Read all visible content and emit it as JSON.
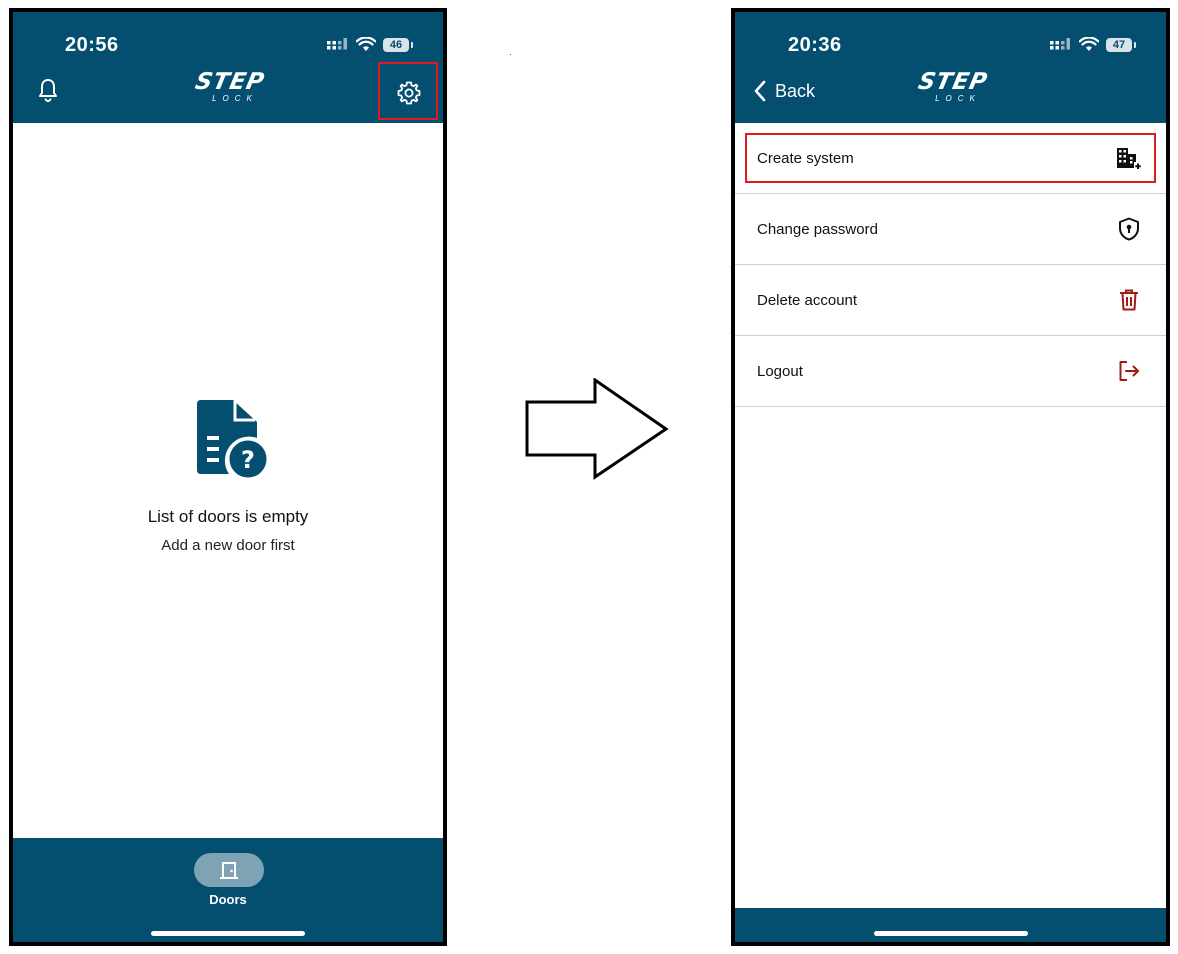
{
  "left_screen": {
    "status": {
      "time": "20:56",
      "battery": "46"
    },
    "header": {
      "logo_main": "STEP",
      "logo_sub": "LOCK",
      "bell_icon": "bell-icon",
      "settings_icon": "gear-icon"
    },
    "empty_state": {
      "icon": "document-question-icon",
      "title": "List of doors is empty",
      "subtitle": "Add a new door first"
    },
    "bottom_nav": {
      "doors_label": "Doors",
      "doors_icon": "door-icon"
    }
  },
  "right_screen": {
    "status": {
      "time": "20:36",
      "battery": "47"
    },
    "header": {
      "back_label": "Back",
      "logo_main": "STEP",
      "logo_sub": "LOCK"
    },
    "menu": [
      {
        "label": "Create system",
        "icon": "building-plus-icon"
      },
      {
        "label": "Change password",
        "icon": "shield-lock-icon"
      },
      {
        "label": "Delete account",
        "icon": "trash-icon"
      },
      {
        "label": "Logout",
        "icon": "logout-icon"
      }
    ]
  },
  "colors": {
    "brand": "#044f70",
    "highlight": "#e01a22",
    "danger_icon": "#a01c10"
  }
}
